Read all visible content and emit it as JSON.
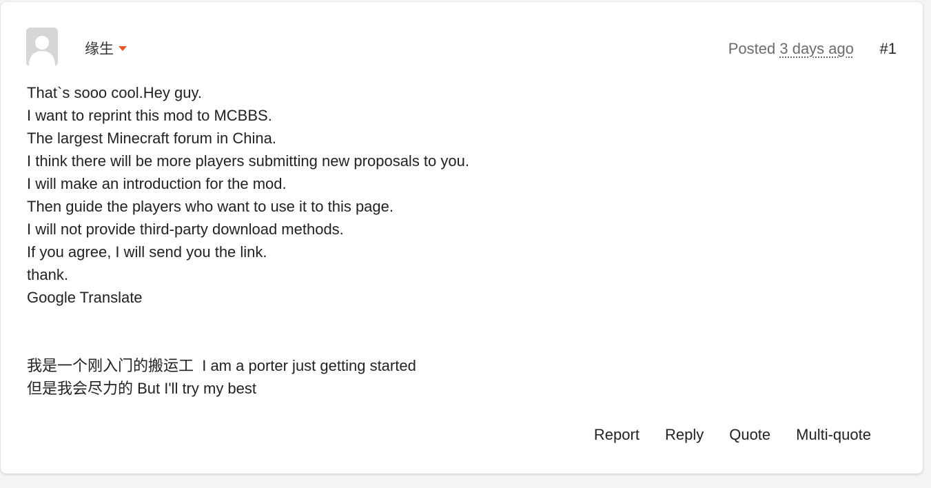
{
  "post": {
    "author": "缘生",
    "posted_prefix": "Posted",
    "posted_time": "3 days ago",
    "post_number": "#1",
    "lines": [
      "That`s sooo cool.Hey guy.",
      "I want to reprint this mod to MCBBS.",
      "The largest Minecraft forum in China.",
      "I think there will be more players submitting new proposals to you.",
      "I will make an introduction for the mod.",
      "Then guide the players who want to use it to this page.",
      "I will not provide third-party download methods.",
      "If you agree, I will send you the link.",
      "thank.",
      "Google Translate"
    ],
    "lines_after_break": [
      "我是一个刚入门的搬运工  I am a porter just getting started",
      "但是我会尽力的 But I'll try my best"
    ]
  },
  "actions": {
    "report": "Report",
    "reply": "Reply",
    "quote": "Quote",
    "multi_quote": "Multi-quote"
  },
  "colors": {
    "accent_caret": "#e8542c",
    "meta_text": "#6b6b6b",
    "body_text": "#222222"
  }
}
